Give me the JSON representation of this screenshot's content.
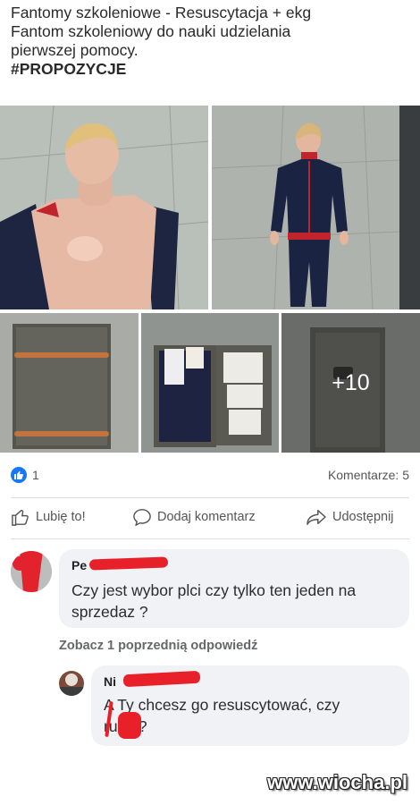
{
  "post": {
    "line1": "Fantomy szkoleniowe - Resuscytacja + ekg",
    "line2": "Fantom szkoleniowy  do nauki udzielania",
    "line3": "pierwszej pomocy.",
    "hashtag": "#PROPOZYCJE"
  },
  "photos": {
    "more_count": "+10"
  },
  "stats": {
    "likes": "1",
    "comments": "Komentarze: 5",
    "like_badge_color": "#1877f2"
  },
  "actions": {
    "like": "Lubię to!",
    "comment": "Dodaj komentarz",
    "share": "Udostępnij"
  },
  "comment1": {
    "author_prefix": "Pe",
    "text": "Czy jest wybor plci czy tylko ten jeden na sprzedaz ?"
  },
  "replies_link": "Zobacz 1 poprzednią odpowiedź",
  "reply1": {
    "author_prefix": "Ni",
    "line1": "A Ty chcesz go resuscytować, czy",
    "line2": "ru   ć?"
  },
  "watermark": "www.wiocha.pl",
  "colors": {
    "redaction": "#e8202a"
  }
}
